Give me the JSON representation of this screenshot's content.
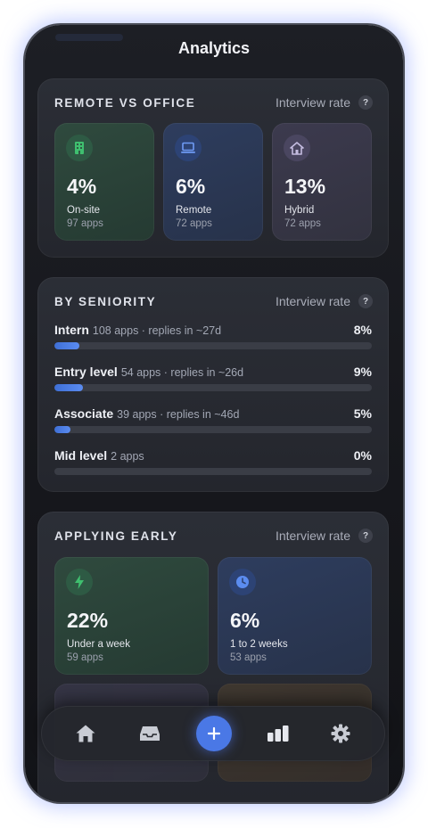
{
  "header": {
    "title": "Analytics"
  },
  "remote_vs_office": {
    "title": "REMOTE VS OFFICE",
    "rate_label": "Interview rate",
    "help": "?",
    "tiles": [
      {
        "value": "4%",
        "label": "On-site",
        "sub": "97 apps",
        "icon": "building-icon",
        "color": "#3fbf6f"
      },
      {
        "value": "6%",
        "label": "Remote",
        "sub": "72 apps",
        "icon": "laptop-icon",
        "color": "#5b8cf0"
      },
      {
        "value": "13%",
        "label": "Hybrid",
        "sub": "72 apps",
        "icon": "home-icon",
        "color": "#b9b0d6"
      }
    ]
  },
  "seniority": {
    "title": "BY SENIORITY",
    "rate_label": "Interview rate",
    "help": "?",
    "rows": [
      {
        "name": "Intern",
        "meta": "108 apps · replies in ~27d",
        "pct": "8%",
        "fill": 0.08
      },
      {
        "name": "Entry level",
        "meta": "54 apps · replies in ~26d",
        "pct": "9%",
        "fill": 0.09
      },
      {
        "name": "Associate",
        "meta": "39 apps · replies in ~46d",
        "pct": "5%",
        "fill": 0.05
      },
      {
        "name": "Mid level",
        "meta": "2 apps",
        "pct": "0%",
        "fill": 0
      }
    ]
  },
  "applying_early": {
    "title": "APPLYING EARLY",
    "rate_label": "Interview rate",
    "help": "?",
    "tiles": [
      {
        "value": "22%",
        "label": "Under a week",
        "sub": "59 apps",
        "icon": "lightning-icon",
        "color": "#3fbf6f"
      },
      {
        "value": "6%",
        "label": "1 to 2 weeks",
        "sub": "53 apps",
        "icon": "clock-icon",
        "color": "#5b8cf0"
      }
    ]
  },
  "nav": {
    "items": [
      "home-icon",
      "inbox-icon",
      "add-icon",
      "bar-chart-icon",
      "gear-icon"
    ],
    "accent": "#4a78e6"
  }
}
